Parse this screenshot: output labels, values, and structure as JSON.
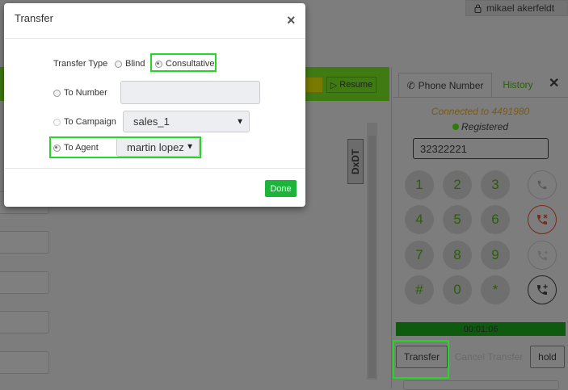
{
  "header": {
    "user_name": "mikael akerfeldt",
    "user_icon": "lock-icon"
  },
  "toolbar": {
    "resume_label": "Resume"
  },
  "scrollbar_tag": "DxDT",
  "phone_panel": {
    "tabs": [
      {
        "label": "Phone Number",
        "icon": "phone-icon"
      },
      {
        "label": "History"
      }
    ],
    "connected_text": "Connected to 4491980",
    "registered_text": "Registered",
    "phone_input_value": "32322221",
    "keypad": [
      "1",
      "2",
      "3",
      "4",
      "5",
      "6",
      "7",
      "8",
      "9",
      "#",
      "0",
      "*"
    ],
    "timer": "00:01:06",
    "transfer_label": "Transfer",
    "cancel_transfer_label": "Cancel Transfer",
    "hold_label": "hold"
  },
  "modal": {
    "title": "Transfer",
    "close_glyph": "×",
    "transfer_type_label": "Transfer Type",
    "type_options": [
      {
        "label": "Blind",
        "selected": false
      },
      {
        "label": "Consultative",
        "selected": true
      }
    ],
    "to_number_label": "To Number",
    "to_number_value": "",
    "to_campaign_label": "To Campaign",
    "campaign_value": "sales_1",
    "to_agent_label": "To Agent",
    "agent_value": "martin lopez",
    "to_agent_selected": true,
    "done_label": "Done"
  },
  "colors": {
    "accent_green": "#1cb43a",
    "highlight": "#22d822",
    "overlay": "#7d7d7d"
  }
}
